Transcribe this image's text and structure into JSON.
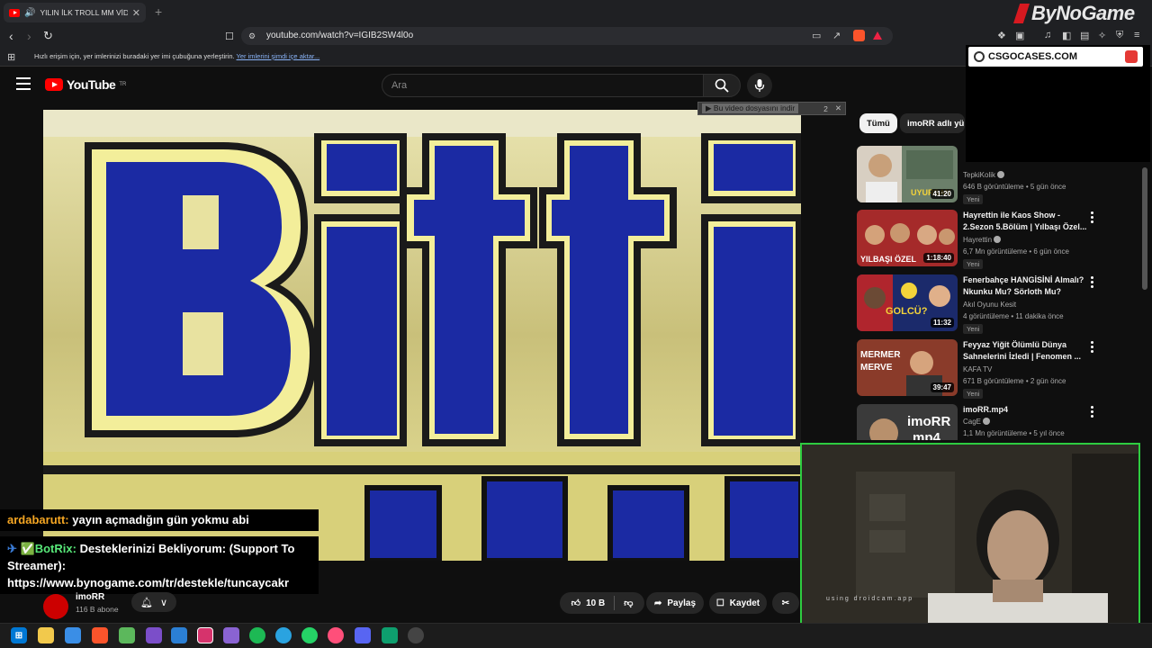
{
  "browser": {
    "tab_title": "YILIN İLK TROLL MM VİDEOSU",
    "tab_speaker": "🔊",
    "tab_close": "✕",
    "new_tab": "+",
    "brand": "ByNoGame",
    "url": "youtube.com/watch?v=IGIB2SW4l0o",
    "bookmarks_text": "Hızlı erişim için, yer imlerinizi buradaki yer imi çubuğuna yerleştirin.",
    "bookmarks_link": "Yer imlerini şimdi içe aktar..."
  },
  "youtube": {
    "logo": "YouTube",
    "region": "TR",
    "search_placeholder": "Ara",
    "download_label": "▶ Bu video dosyasını indir",
    "download_count": "2",
    "download_close": "✕"
  },
  "chat": {
    "msg1_user": "ardabarutt:",
    "msg1_text": "yayın açmadığın gün yokmu abi",
    "msg2_user": "✅BotRix:",
    "msg2_text": "Desteklerinizi Bekliyorum: (Support To Streamer): https://www.bynogame.com/tr/destekle/tuncaycakr"
  },
  "channel": {
    "name": "imoRR",
    "subs": "116 B abone",
    "likes": "10 B",
    "share": "Paylaş",
    "save": "Kaydet"
  },
  "sidebar": {
    "chips": [
      "Tümü",
      "imoRR adlı yüklenen"
    ],
    "ad_text": "CSGOCASES.COM",
    "videos": [
      {
        "title": "",
        "channel": "TepkiKolik",
        "meta": "646 B görüntüleme • 5 gün önce",
        "badge": "Yeni",
        "duration": "41:20",
        "thumb_text": "UYURSAN ÖLÜRSÜN"
      },
      {
        "title": "Hayrettin ile Kaos Show - 2.Sezon 5.Bölüm | Yılbaşı Özel...",
        "channel": "Hayrettin",
        "meta": "6,7 Mn görüntüleme • 6 gün önce",
        "badge": "Yeni",
        "duration": "1:18:40",
        "thumb_text": "YILBAŞI ÖZEL"
      },
      {
        "title": "Fenerbahçe HANGİSİNİ Almalı? Nkunku Mu? Sörloth Mu?",
        "channel": "Akıl Oyunu Kesit",
        "meta": "4 görüntüleme • 11 dakika önce",
        "badge": "Yeni",
        "duration": "11:32",
        "thumb_text": "GOLCÜ?"
      },
      {
        "title": "Feyyaz Yiğit Ölümlü Dünya Sahnelerini İzledi | Fenomen ...",
        "channel": "KAFA TV",
        "meta": "671 B görüntüleme • 2 gün önce",
        "badge": "Yeni",
        "duration": "39:47",
        "thumb_text": "MERMER MERVE"
      },
      {
        "title": "imoRR.mp4",
        "channel": "CagE",
        "meta": "1,1 Mn görüntüleme • 5 yıl önce",
        "badge": "",
        "duration": "",
        "thumb_text": "imoRR mp4"
      }
    ]
  },
  "video_overlay_text": "Bitti",
  "webcam_watermark": "using droidcam.app",
  "colors": {
    "yt_red": "#ff0000",
    "cam_border": "#2ecc40",
    "video_blue": "#1e2fa8",
    "video_yellow": "#e9e08a"
  }
}
